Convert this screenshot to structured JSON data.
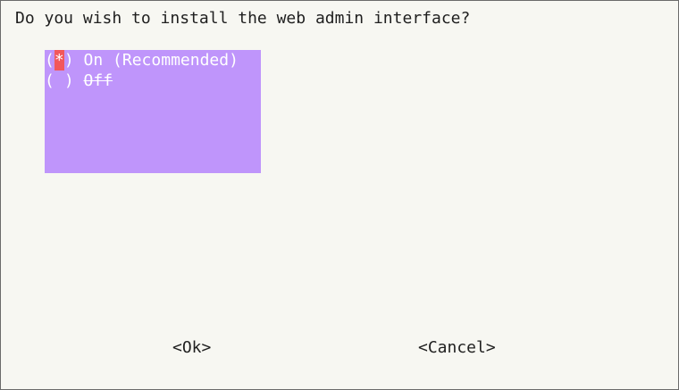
{
  "dialog": {
    "question": "Do you wish to install the web admin interface?"
  },
  "options": [
    {
      "open": "(",
      "mark": "*",
      "close": ")",
      "label": "On (Recommended)",
      "selected": true
    },
    {
      "open": "(",
      "mark": " ",
      "close": ")",
      "label": "Off",
      "selected": false
    }
  ],
  "buttons": {
    "ok": "<Ok>",
    "cancel": "<Cancel>"
  },
  "colors": {
    "background": "#f7f7f2",
    "list_background": "#bf95fb",
    "cursor": "#f2575c",
    "text": "#1f1f1f"
  }
}
